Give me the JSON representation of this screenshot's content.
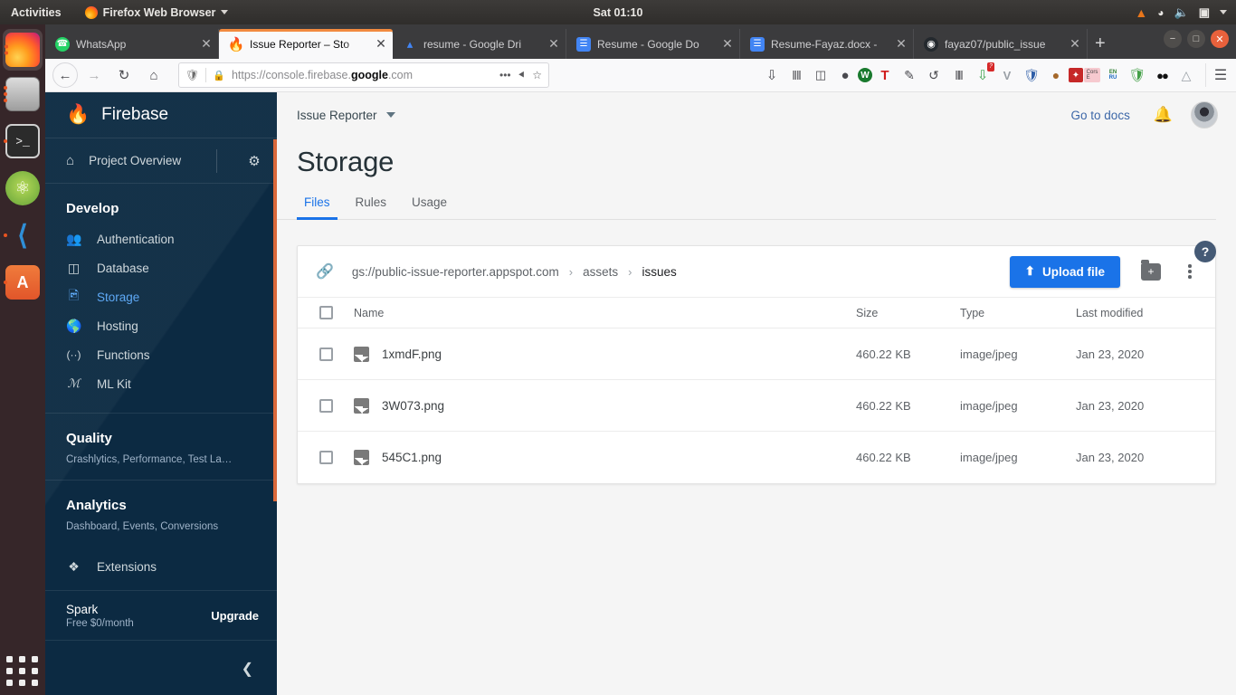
{
  "os_bar": {
    "activities": "Activities",
    "app_menu": "Firefox Web Browser",
    "clock": "Sat 01:10",
    "tray_icons": [
      "vlc-cone-icon",
      "wifi-icon",
      "volume-icon",
      "battery-icon",
      "system-menu-caret-icon"
    ]
  },
  "dock": {
    "items": [
      {
        "name": "firefox",
        "icon": "firefox-icon",
        "dots": 2,
        "active": true
      },
      {
        "name": "files",
        "icon": "files-icon",
        "dots": 3,
        "active": false
      },
      {
        "name": "terminal",
        "icon": "terminal-icon",
        "glyph": ">_",
        "dots": 1,
        "active": false
      },
      {
        "name": "android-studio",
        "icon": "android-studio-icon",
        "glyph": "⚙",
        "dots": 0,
        "active": false
      },
      {
        "name": "vscode",
        "icon": "vscode-icon",
        "glyph": "⌨",
        "dots": 1,
        "active": false
      },
      {
        "name": "ubuntu-software",
        "icon": "ubuntu-software-icon",
        "glyph": "A",
        "dots": 1,
        "active": false
      }
    ],
    "app_grid": "show-applications"
  },
  "browser": {
    "tabs": [
      {
        "title": "WhatsApp",
        "favicon": "whatsapp-icon",
        "active": false
      },
      {
        "title": "Issue Reporter – Sto",
        "favicon": "firebase-icon",
        "active": true
      },
      {
        "title": "resume - Google Dri",
        "favicon": "google-drive-icon",
        "active": false
      },
      {
        "title": "Resume - Google Do",
        "favicon": "google-docs-icon",
        "active": false
      },
      {
        "title": "Resume-Fayaz.docx -",
        "favicon": "google-docs-icon",
        "active": false
      },
      {
        "title": "fayaz07/public_issue",
        "favicon": "github-icon",
        "active": false
      }
    ],
    "new_tab_label": "+",
    "window_controls": {
      "minimize": "−",
      "maximize": "□",
      "close": "✕"
    },
    "nav": {
      "back": "←",
      "forward": "→",
      "reload": "↻",
      "home": "⌂"
    },
    "url": {
      "prefix": "https://console.firebase.",
      "bold": "google",
      "suffix": ".com"
    },
    "url_actions": {
      "more": "•••",
      "pocket": "⯇",
      "bookmark": "☆"
    },
    "extensions": [
      {
        "name": "downloads-icon",
        "glyph": "⤓"
      },
      {
        "name": "library-icon",
        "glyph": "‖‖"
      },
      {
        "name": "reader-view-icon",
        "glyph": "▥"
      },
      {
        "name": "account-icon",
        "glyph": "◔"
      },
      {
        "name": "wikipedia-extension-icon",
        "glyph": "W"
      },
      {
        "name": "text-tool-icon",
        "glyph": "T"
      },
      {
        "name": "colorpicker-icon",
        "glyph": "✒"
      },
      {
        "name": "loop-icon",
        "glyph": "↺"
      },
      {
        "name": "comb-icon",
        "glyph": "⌸"
      },
      {
        "name": "video-downloader-icon",
        "glyph": "⬇",
        "badge": "?"
      },
      {
        "name": "vue-devtools-icon",
        "glyph": "V"
      },
      {
        "name": "shield-icon",
        "glyph": "⛨"
      },
      {
        "name": "cookie-manager-icon",
        "glyph": "●"
      },
      {
        "name": "magic-wand-icon",
        "glyph": "✦"
      },
      {
        "name": "cors-toggle-icon",
        "glyph": "Cors"
      },
      {
        "name": "translate-icon",
        "glyph": "EN"
      },
      {
        "name": "adguard-icon",
        "glyph": "✓"
      },
      {
        "name": "dark-reader-icon",
        "glyph": "●●"
      },
      {
        "name": "privacy-badger-icon",
        "glyph": "▽"
      }
    ],
    "menu_button": "hamburger-menu"
  },
  "firebase": {
    "logo_text": "Firebase",
    "project_overview": "Project Overview",
    "settings_icon": "gear-icon",
    "sections": [
      {
        "title": "Develop",
        "items": [
          {
            "label": "Authentication",
            "icon": "people-icon",
            "selected": false
          },
          {
            "label": "Database",
            "icon": "database-icon",
            "selected": false
          },
          {
            "label": "Storage",
            "icon": "image-folder-icon",
            "selected": true
          },
          {
            "label": "Hosting",
            "icon": "globe-icon",
            "selected": false
          },
          {
            "label": "Functions",
            "icon": "functions-icon",
            "selected": false
          },
          {
            "label": "ML Kit",
            "icon": "ml-kit-icon",
            "selected": false
          }
        ]
      },
      {
        "title": "Quality",
        "subtitle": "Crashlytics, Performance, Test La…",
        "items": []
      },
      {
        "title": "Analytics",
        "subtitle": "Dashboard, Events, Conversions",
        "items": []
      }
    ],
    "extensions_item": {
      "label": "Extensions",
      "icon": "puzzle-icon"
    },
    "plan": {
      "name": "Spark",
      "price": "Free $0/month",
      "upgrade": "Upgrade"
    },
    "collapse_icon": "chevron-left-icon",
    "topnav": {
      "project_name": "Issue Reporter",
      "project_caret": "chevron-down-icon",
      "go_to_docs": "Go to docs",
      "bell_icon": "notifications-bell-icon",
      "avatar": "user-avatar",
      "help": "?"
    },
    "page_title": "Storage",
    "tabs": [
      {
        "label": "Files",
        "active": true
      },
      {
        "label": "Rules",
        "active": false
      },
      {
        "label": "Usage",
        "active": false
      }
    ],
    "files_panel": {
      "link_icon": "link-icon",
      "breadcrumb": [
        {
          "label": "gs://public-issue-reporter.appspot.com",
          "current": false
        },
        {
          "label": "assets",
          "current": false
        },
        {
          "label": "issues",
          "current": true
        }
      ],
      "breadcrumb_separator": "›",
      "upload_button": {
        "label": "Upload file",
        "icon": "upload-icon"
      },
      "new_folder_button": "create-folder-icon",
      "overflow_button": "more-options-icon",
      "columns": [
        "Name",
        "Size",
        "Type",
        "Last modified"
      ],
      "rows": [
        {
          "name": "1xmdF.png",
          "size": "460.22 KB",
          "type": "image/jpeg",
          "modified": "Jan 23, 2020",
          "icon": "image-thumbnail-icon"
        },
        {
          "name": "3W073.png",
          "size": "460.22 KB",
          "type": "image/jpeg",
          "modified": "Jan 23, 2020",
          "icon": "image-thumbnail-icon"
        },
        {
          "name": "545C1.png",
          "size": "460.22 KB",
          "type": "image/jpeg",
          "modified": "Jan 23, 2020",
          "icon": "image-thumbnail-icon"
        }
      ]
    },
    "colors": {
      "accent": "#1a73e8",
      "sidebar": "#0c2a42",
      "selected": "#5ea9f5",
      "flame": "#ffa000"
    }
  }
}
